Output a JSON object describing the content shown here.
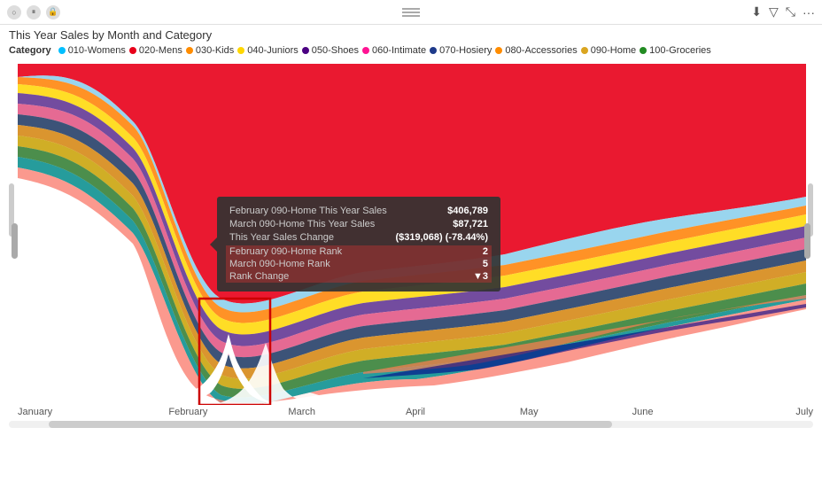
{
  "title": "This Year Sales by Month and Category",
  "topbar": {
    "icons": [
      "circle-icon",
      "pause-icon",
      "lock-icon"
    ],
    "right_icons": [
      "download-icon",
      "filter-icon",
      "expand-icon",
      "more-icon"
    ]
  },
  "legend": {
    "prefix": "Category",
    "items": [
      {
        "label": "010-Womens",
        "color": "#00BFFF"
      },
      {
        "label": "020-Mens",
        "color": "#E8001A"
      },
      {
        "label": "030-Kids",
        "color": "#FF8C00"
      },
      {
        "label": "040-Juniors",
        "color": "#FFD700"
      },
      {
        "label": "050-Shoes",
        "color": "#4B0082"
      },
      {
        "label": "060-Intimate",
        "color": "#FF1493"
      },
      {
        "label": "070-Hosiery",
        "color": "#1E3A8A"
      },
      {
        "label": "080-Accessories",
        "color": "#FF8C00"
      },
      {
        "label": "090-Home",
        "color": "#DAA520"
      },
      {
        "label": "100-Groceries",
        "color": "#228B22"
      }
    ]
  },
  "tooltip": {
    "rows": [
      {
        "key": "February 090-Home This Year Sales",
        "value": "$406,789"
      },
      {
        "key": "March 090-Home This Year Sales",
        "value": "$87,721"
      },
      {
        "key": "This Year Sales Change",
        "value": "($319,068) (-78.44%)"
      },
      {
        "key": "February 090-Home Rank",
        "value": "2",
        "highlight": true
      },
      {
        "key": "March 090-Home Rank",
        "value": "5",
        "highlight": true
      },
      {
        "key": "Rank Change",
        "value": "▼3",
        "highlight": true
      }
    ]
  },
  "xaxis": {
    "labels": [
      "January",
      "February",
      "March",
      "April",
      "May",
      "June",
      "July"
    ]
  },
  "chart": {
    "colors": {
      "womens": "#00BFFF",
      "mens": "#E8001A",
      "kids": "#FF7F00",
      "juniors": "#FFD700",
      "shoes": "#5B2D8E",
      "intimate": "#E05080",
      "hosiery": "#1A3560",
      "accessories": "#D4820A",
      "home": "#C8A000",
      "groceries": "#2D7A2D",
      "teal": "#008B8B",
      "lightblue": "#87CEEB",
      "salmon": "#FA8072",
      "purple": "#9370DB",
      "coral": "#FF7F50",
      "white": "#FFFFFF",
      "gray": "#808080",
      "darkblue": "#00008B",
      "orange": "#FFA500"
    }
  }
}
